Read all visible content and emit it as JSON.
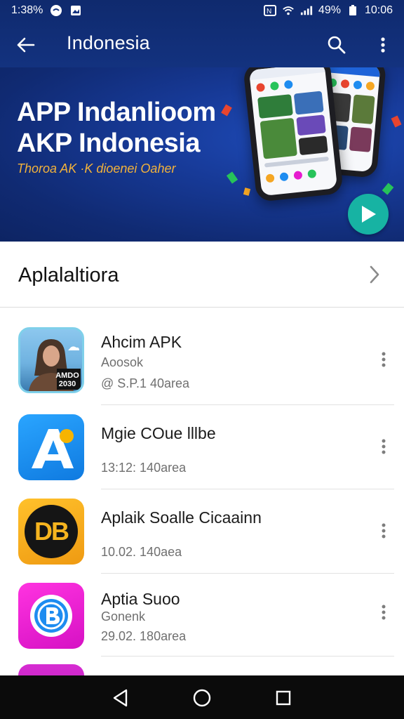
{
  "status": {
    "time": "1:38%",
    "battery": "49%",
    "clock": "10:06"
  },
  "appbar": {
    "title": "Indonesia"
  },
  "hero": {
    "line1": "APP Indanlioom",
    "line2": "AKP Indonesia",
    "subtitle": "Thoroa AK ·K dioenei Oaher"
  },
  "section": {
    "label": "Aplalaltiora"
  },
  "apps": [
    {
      "name": "Ahcim APK",
      "sub": "Aoosok",
      "meta": "@ S.P.1 40area",
      "icon": "woman-photo-icon",
      "badge": "AMDO 2030"
    },
    {
      "name": "Mgie COue lllbe",
      "sub": "",
      "meta": "13:12: 140area",
      "icon": "letter-a-icon",
      "color": "#1e8cf0"
    },
    {
      "name": "Aplaik Soalle Cicaainn",
      "sub": "",
      "meta": "10.02. 140aea",
      "icon": "db-badge-icon",
      "letters": "DB",
      "color": "#f0a21a"
    },
    {
      "name": "Aptia Suoo",
      "sub": "Gonenk",
      "meta": "29.02. 180area",
      "icon": "shield-b-icon",
      "color": "#e61ccf"
    }
  ],
  "nav": {
    "back": "back-nav-icon",
    "home": "home-nav-icon",
    "recents": "recents-nav-icon"
  }
}
